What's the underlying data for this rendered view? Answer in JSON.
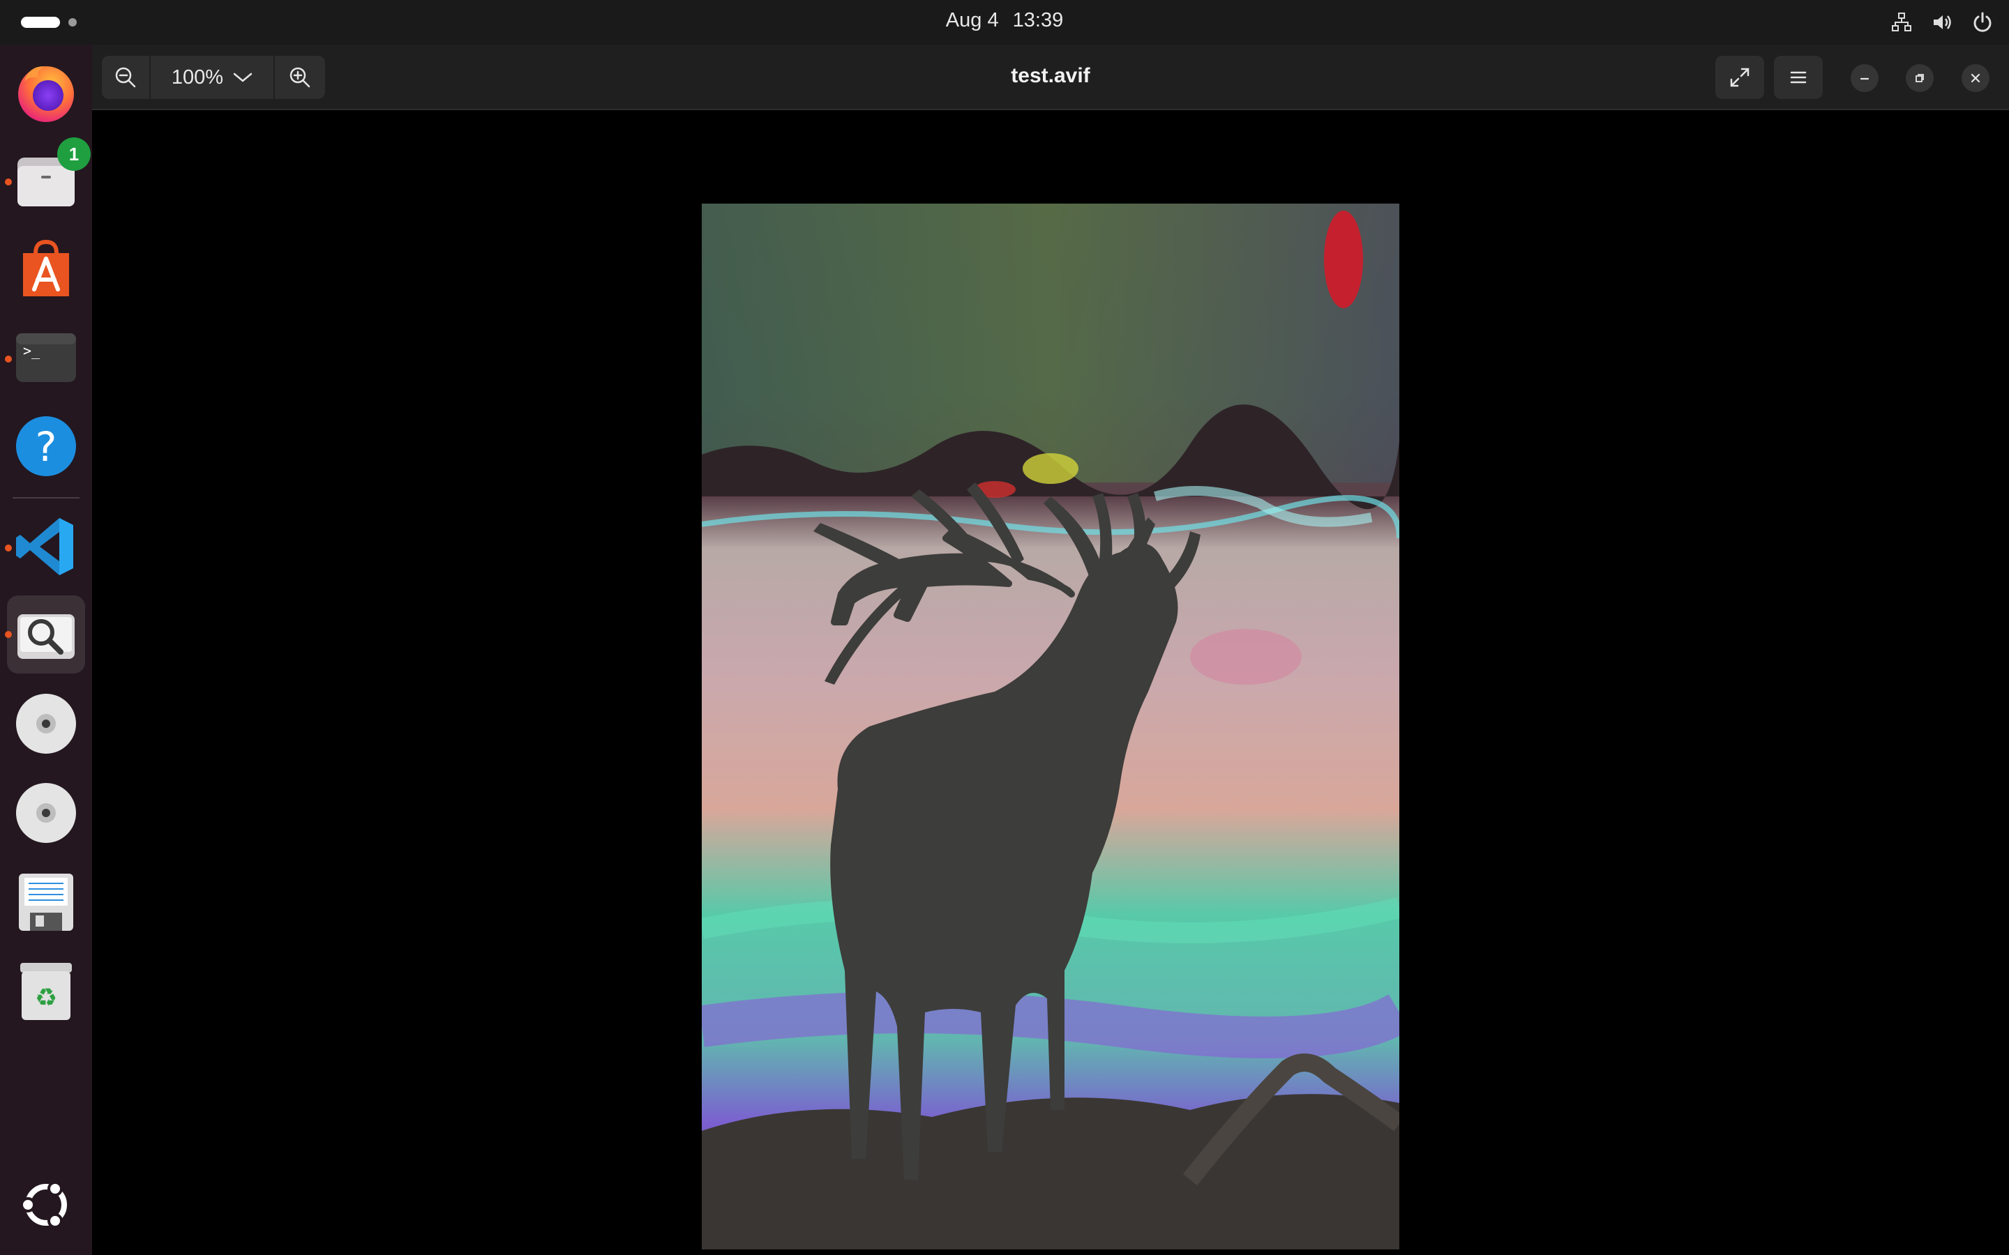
{
  "topbar": {
    "date": "Aug 4",
    "time": "13:39",
    "tray_icons": [
      "network-icon",
      "volume-icon",
      "power-icon"
    ]
  },
  "dock": {
    "items": [
      {
        "name": "firefox",
        "icon": "firefox-icon",
        "running": false
      },
      {
        "name": "files",
        "icon": "files-icon",
        "running": true,
        "badge": "1"
      },
      {
        "name": "app-center",
        "icon": "app-center-icon",
        "running": false
      },
      {
        "name": "terminal",
        "icon": "terminal-icon",
        "running": true
      },
      {
        "name": "help",
        "icon": "help-icon",
        "running": false
      },
      {
        "name": "vscode",
        "icon": "vscode-icon",
        "running": true
      },
      {
        "name": "image-viewer",
        "icon": "image-viewer-icon",
        "running": true,
        "active": true
      },
      {
        "name": "disc-1",
        "icon": "optical-disc-icon",
        "running": false
      },
      {
        "name": "disc-2",
        "icon": "optical-disc-icon",
        "running": false
      },
      {
        "name": "save-manager",
        "icon": "floppy-document-icon",
        "running": false
      },
      {
        "name": "trash",
        "icon": "trash-icon",
        "running": false
      }
    ],
    "show_apps_icon": "ubuntu-logo-icon"
  },
  "window": {
    "title": "test.avif",
    "zoom_level": "100%",
    "colors": {
      "accent": "#e95420",
      "headerbar": "#1f1f1f",
      "dock": "#24171f"
    }
  }
}
